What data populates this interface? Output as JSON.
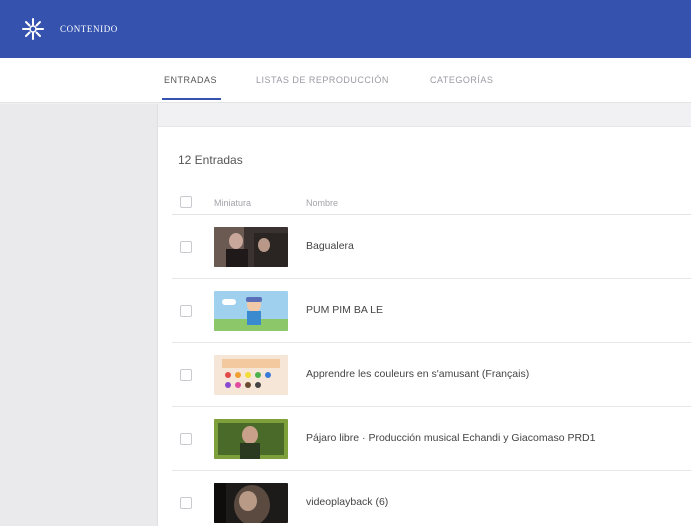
{
  "app": {
    "title": "CONTENIDO",
    "accent": "#3452ae"
  },
  "tabs": [
    {
      "label": "ENTRADAS",
      "active": true
    },
    {
      "label": "LISTAS DE REPRODUCCIÓN",
      "active": false
    },
    {
      "label": "CATEGORÍAS",
      "active": false
    }
  ],
  "entries": {
    "count_label": "12 Entradas",
    "columns": [
      "Miniatura",
      "Nombre"
    ],
    "rows": [
      {
        "name": "Bagualera",
        "thumb": "video-thumbnail"
      },
      {
        "name": "PUM PIM BA LE",
        "thumb": "video-thumbnail"
      },
      {
        "name": "Apprendre les couleurs en s'amusant (Français)",
        "thumb": "video-thumbnail"
      },
      {
        "name": "Pájaro libre · Producción musical Echandi y Giacomaso PRD1",
        "thumb": "video-thumbnail"
      },
      {
        "name": "videoplayback (6)",
        "thumb": "video-thumbnail"
      }
    ]
  }
}
